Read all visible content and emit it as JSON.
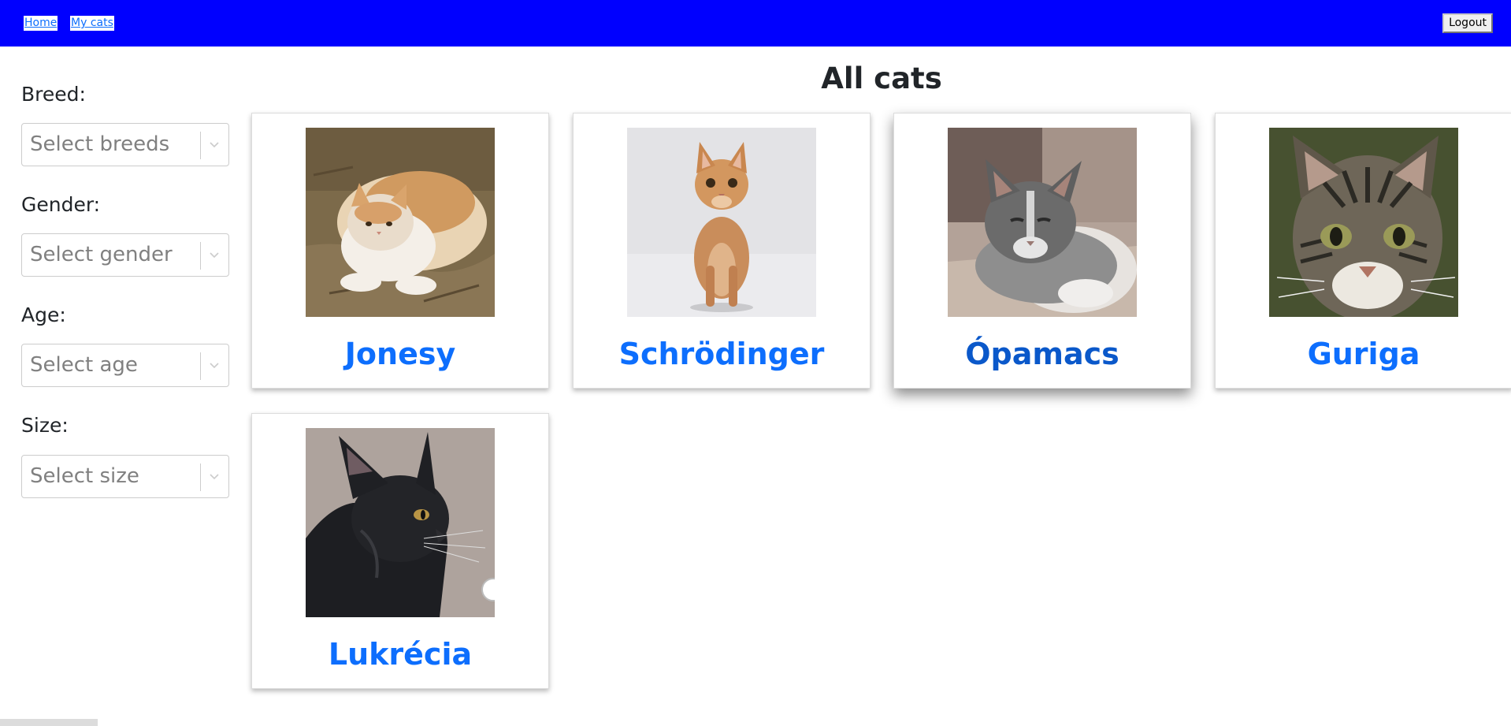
{
  "nav": {
    "home_label": "Home",
    "my_cats_label": "My cats",
    "logout_label": "Logout",
    "bar_color": "#0000ff"
  },
  "filters": {
    "breed": {
      "label": "Breed:",
      "placeholder": "Select breeds"
    },
    "gender": {
      "label": "Gender:",
      "placeholder": "Select gender"
    },
    "age": {
      "label": "Age:",
      "placeholder": "Select age"
    },
    "size": {
      "label": "Size:",
      "placeholder": "Select size"
    }
  },
  "main": {
    "title": "All cats",
    "link_color": "#0d6efd",
    "cats": [
      {
        "name": "Jonesy",
        "photo": "ginger-white-cat-crouching-on-dirt"
      },
      {
        "name": "Schrödinger",
        "photo": "ginger-tabby-kitten-sitting-on-snow"
      },
      {
        "name": "Ópamacs",
        "photo": "grey-white-cat-lying-on-cushion"
      },
      {
        "name": "Guriga",
        "photo": "tabby-kitten-face-closeup"
      },
      {
        "name": "Lukrécia",
        "photo": "black-cat-side-profile"
      }
    ]
  }
}
